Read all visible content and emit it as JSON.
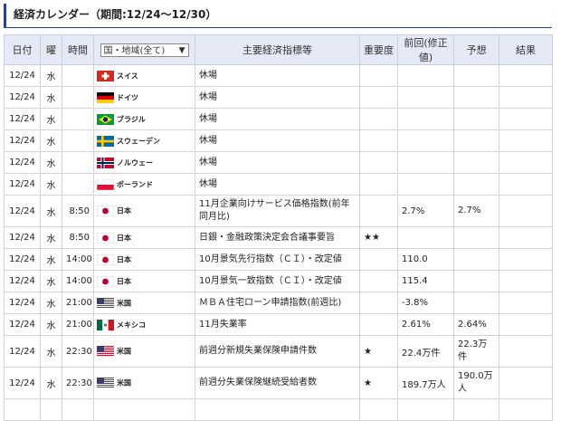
{
  "title": "経済カレンダー（期間:12/24〜12/30）",
  "headers": {
    "date": "日付",
    "dow": "曜",
    "time": "時間",
    "country_select": "国・地域(全て)",
    "indicator": "主要経済指標等",
    "importance": "重要度",
    "previous": "前回(修正値)",
    "forecast": "予想",
    "result": "結果"
  },
  "rows": [
    {
      "date": "12/24",
      "dow": "水",
      "time": "",
      "flag": "switzerland-flag-icon",
      "country": "スイス",
      "indicator": "休場",
      "importance": "",
      "previous": "",
      "forecast": "",
      "result": ""
    },
    {
      "date": "12/24",
      "dow": "水",
      "time": "",
      "flag": "germany-flag-icon",
      "country": "ドイツ",
      "indicator": "休場",
      "importance": "",
      "previous": "",
      "forecast": "",
      "result": ""
    },
    {
      "date": "12/24",
      "dow": "水",
      "time": "",
      "flag": "brazil-flag-icon",
      "country": "ブラジル",
      "indicator": "休場",
      "importance": "",
      "previous": "",
      "forecast": "",
      "result": ""
    },
    {
      "date": "12/24",
      "dow": "水",
      "time": "",
      "flag": "sweden-flag-icon",
      "country": "スウェーデン",
      "indicator": "休場",
      "importance": "",
      "previous": "",
      "forecast": "",
      "result": ""
    },
    {
      "date": "12/24",
      "dow": "水",
      "time": "",
      "flag": "norway-flag-icon",
      "country": "ノルウェー",
      "indicator": "休場",
      "importance": "",
      "previous": "",
      "forecast": "",
      "result": ""
    },
    {
      "date": "12/24",
      "dow": "水",
      "time": "",
      "flag": "poland-flag-icon",
      "country": "ポーランド",
      "indicator": "休場",
      "importance": "",
      "previous": "",
      "forecast": "",
      "result": ""
    },
    {
      "date": "12/24",
      "dow": "水",
      "time": "8:50",
      "flag": "japan-flag-icon",
      "country": "日本",
      "indicator": "11月企業向けサービス価格指数(前年同月比)",
      "importance": "",
      "previous": "2.7%",
      "forecast": "2.7%",
      "result": ""
    },
    {
      "date": "12/24",
      "dow": "水",
      "time": "8:50",
      "flag": "japan-flag-icon",
      "country": "日本",
      "indicator": "日銀・金融政策決定会合議事要旨",
      "importance": "★★",
      "previous": "",
      "forecast": "",
      "result": ""
    },
    {
      "date": "12/24",
      "dow": "水",
      "time": "14:00",
      "flag": "japan-flag-icon",
      "country": "日本",
      "indicator": "10月景気先行指数（ＣＩ）・改定値",
      "importance": "",
      "previous": "110.0",
      "forecast": "",
      "result": ""
    },
    {
      "date": "12/24",
      "dow": "水",
      "time": "14:00",
      "flag": "japan-flag-icon",
      "country": "日本",
      "indicator": "10月景気一致指数（ＣＩ）・改定値",
      "importance": "",
      "previous": "115.4",
      "forecast": "",
      "result": ""
    },
    {
      "date": "12/24",
      "dow": "水",
      "time": "21:00",
      "flag": "usa-flag-icon",
      "country": "米国",
      "indicator": "ＭＢＡ住宅ローン申請指数(前週比)",
      "importance": "",
      "previous": "-3.8%",
      "forecast": "",
      "result": ""
    },
    {
      "date": "12/24",
      "dow": "水",
      "time": "21:00",
      "flag": "mexico-flag-icon",
      "country": "メキシコ",
      "indicator": "11月失業率",
      "importance": "",
      "previous": "2.61%",
      "forecast": "2.64%",
      "result": ""
    },
    {
      "date": "12/24",
      "dow": "水",
      "time": "22:30",
      "flag": "usa-flag-icon",
      "country": "米国",
      "indicator": "前週分新規失業保険申請件数",
      "importance": "★",
      "previous": "22.4万件",
      "forecast": "22.3万件",
      "result": ""
    },
    {
      "date": "12/24",
      "dow": "水",
      "time": "22:30",
      "flag": "usa-flag-icon",
      "country": "米国",
      "indicator": "前週分失業保険継続受給者数",
      "importance": "★",
      "previous": "189.7万人",
      "forecast": "190.0万人",
      "result": ""
    },
    {
      "date": "",
      "dow": "",
      "time": "",
      "flag": "",
      "country": "",
      "indicator": "",
      "importance": "",
      "previous": "",
      "forecast": "",
      "result": ""
    }
  ],
  "colors": {
    "accent": "#2b3f97",
    "header_bg": "#e6eaf6",
    "border": "#d4d4d4"
  }
}
